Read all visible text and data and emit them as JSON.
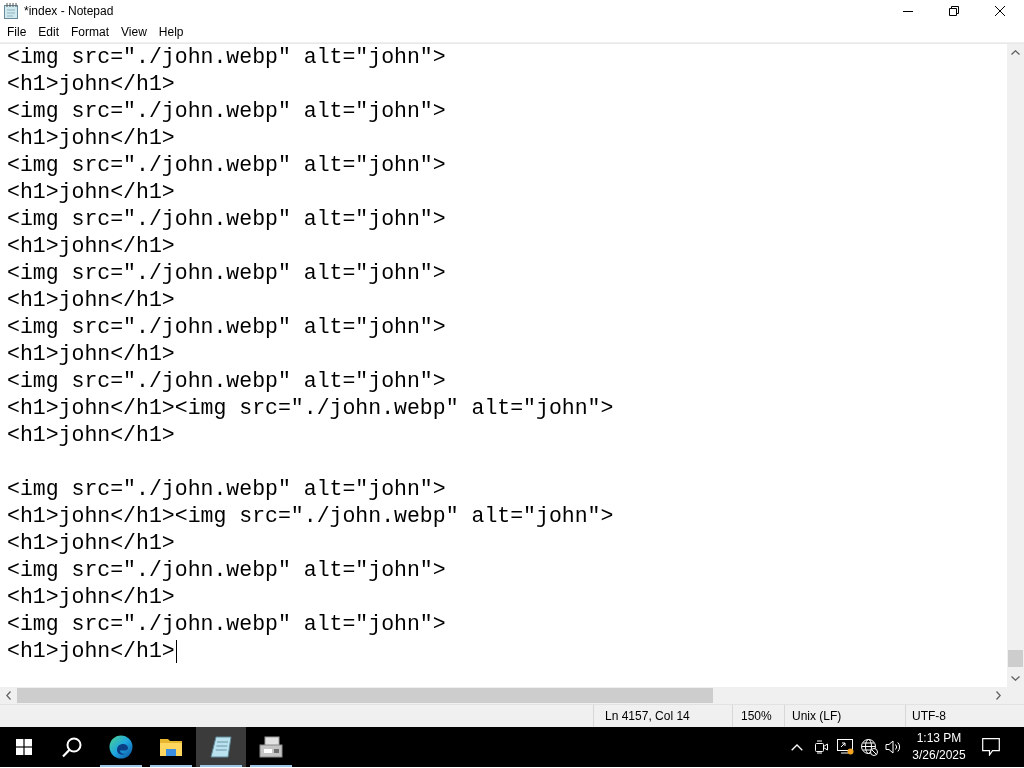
{
  "window": {
    "title": "*index - Notepad"
  },
  "menu": [
    "File",
    "Edit",
    "Format",
    "View",
    "Help"
  ],
  "editor": {
    "lines": [
      {
        "kind": "code",
        "text": "<img src=\"./john.webp\" alt=\"john\">",
        "caret": false
      },
      {
        "kind": "code",
        "text": "<h1>john</h1>",
        "caret": false
      },
      {
        "kind": "code",
        "text": "<img src=\"./john.webp\" alt=\"john\">",
        "caret": false
      },
      {
        "kind": "code",
        "text": "<h1>john</h1>",
        "caret": false
      },
      {
        "kind": "code",
        "text": "<img src=\"./john.webp\" alt=\"john\">",
        "caret": false
      },
      {
        "kind": "code",
        "text": "<h1>john</h1>",
        "caret": false
      },
      {
        "kind": "code",
        "text": "<img src=\"./john.webp\" alt=\"john\">",
        "caret": false
      },
      {
        "kind": "code",
        "text": "<h1>john</h1>",
        "caret": false
      },
      {
        "kind": "code",
        "text": "<img src=\"./john.webp\" alt=\"john\">",
        "caret": false
      },
      {
        "kind": "code",
        "text": "<h1>john</h1>",
        "caret": false
      },
      {
        "kind": "code",
        "text": "<img src=\"./john.webp\" alt=\"john\">",
        "caret": false
      },
      {
        "kind": "code",
        "text": "<h1>john</h1>",
        "caret": false
      },
      {
        "kind": "code",
        "text": "<img src=\"./john.webp\" alt=\"john\">",
        "caret": false
      },
      {
        "kind": "code",
        "text": "<h1>john</h1><img src=\"./john.webp\" alt=\"john\">",
        "caret": false
      },
      {
        "kind": "code",
        "text": "<h1>john</h1>",
        "caret": false
      },
      {
        "kind": "blank",
        "caret": false
      },
      {
        "kind": "code",
        "text": "<img src=\"./john.webp\" alt=\"john\">",
        "caret": false
      },
      {
        "kind": "code",
        "text": "<h1>john</h1><img src=\"./john.webp\" alt=\"john\">",
        "caret": false
      },
      {
        "kind": "code",
        "text": "<h1>john</h1>",
        "caret": false
      },
      {
        "kind": "code",
        "text": "<img src=\"./john.webp\" alt=\"john\">",
        "caret": false
      },
      {
        "kind": "code",
        "text": "<h1>john</h1>",
        "caret": false
      },
      {
        "kind": "code",
        "text": "<img src=\"./john.webp\" alt=\"john\">",
        "caret": false
      },
      {
        "kind": "code",
        "text": "<h1>john</h1>",
        "caret": true
      }
    ]
  },
  "status_bar": {
    "position": "Ln 4157, Col 14",
    "zoom": "150%",
    "line_ending": "Unix (LF)",
    "encoding": "UTF-8"
  },
  "taskbar": {
    "apps": [
      {
        "kind": "browser",
        "running": true,
        "selected": false
      },
      {
        "kind": "folder",
        "running": true,
        "selected": false
      },
      {
        "kind": "notepad",
        "running": true,
        "selected": true
      },
      {
        "kind": "printer",
        "running": true,
        "selected": false
      }
    ],
    "clock": {
      "time": "1:13 PM",
      "date": "3/26/2025"
    }
  }
}
